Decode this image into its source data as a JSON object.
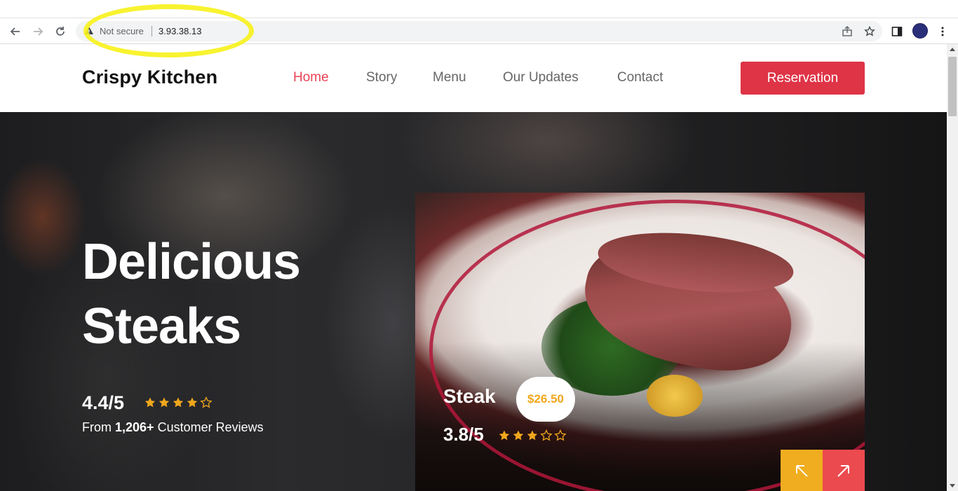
{
  "browser": {
    "security_label": "Not secure",
    "url": "3.93.38.13",
    "icons": [
      "back-arrow-icon",
      "forward-arrow-icon",
      "reload-icon",
      "warning-icon",
      "share-icon",
      "bookmark-star-icon",
      "side-panel-icon",
      "profile-avatar",
      "more-menu-icon"
    ]
  },
  "header": {
    "brand": "Crispy Kitchen",
    "nav": [
      {
        "label": "Home",
        "active": true
      },
      {
        "label": "Story",
        "active": false
      },
      {
        "label": "Menu",
        "active": false
      },
      {
        "label": "Our Updates",
        "active": false
      },
      {
        "label": "Contact",
        "active": false
      }
    ],
    "cta": "Reservation"
  },
  "hero": {
    "title_line1": "Delicious",
    "title_line2": "Steaks",
    "rating": "4.4/5",
    "rating_stars_filled": 4,
    "rating_stars_total": 5,
    "reviews_prefix": "From",
    "reviews_count": "1,206+",
    "reviews_suffix": "Customer Reviews"
  },
  "featured": {
    "name": "Steak",
    "price": "$26.50",
    "rating": "3.8/5",
    "rating_stars_filled": 3,
    "rating_stars_total": 5
  },
  "colors": {
    "accent_red": "#de3446",
    "active_nav": "#e94055",
    "star": "#f0a71d",
    "prev_button": "#f0ad1f",
    "next_button": "#eb4a4f",
    "highlight": "#f7f21a"
  }
}
